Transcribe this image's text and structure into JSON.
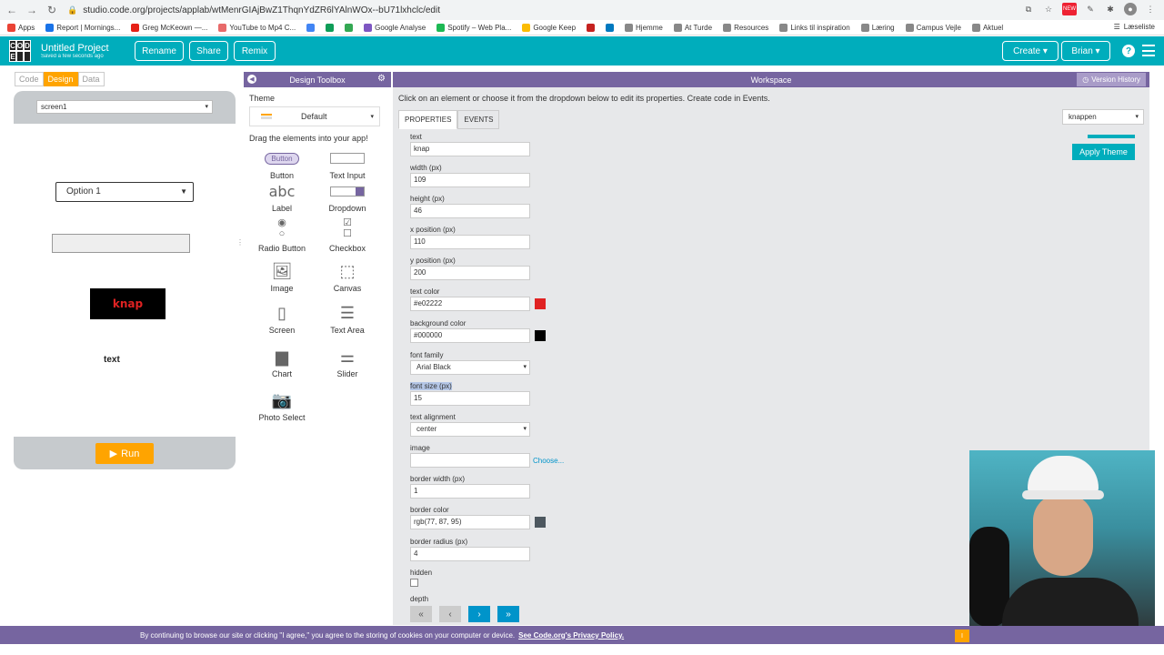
{
  "browser": {
    "url": "studio.code.org/projects/applab/wtMenrGIAjBwZ1ThqnYdZR6lYAlnWOx--bU71lxhclc/edit",
    "bookmarks": [
      {
        "label": "Apps",
        "color": "#ea4335"
      },
      {
        "label": "Report | Mornings...",
        "color": "#1a73e8"
      },
      {
        "label": "Greg McKeown —...",
        "color": "#e62117"
      },
      {
        "label": "YouTube to Mp4 C...",
        "color": "#e86a6a"
      },
      {
        "label": "",
        "color": "#4285f4"
      },
      {
        "label": "",
        "color": "#0f9d58"
      },
      {
        "label": "",
        "color": "#34a853"
      },
      {
        "label": "Google Analyse",
        "color": "#7e57c2"
      },
      {
        "label": "Spotify – Web Pla...",
        "color": "#1db954"
      },
      {
        "label": "Google Keep",
        "color": "#fbbc04"
      },
      {
        "label": "",
        "color": "#c5221f"
      },
      {
        "label": "",
        "color": "#0079bf"
      },
      {
        "label": "Hjemme",
        "color": "#888888"
      },
      {
        "label": "At Turde",
        "color": "#888888"
      },
      {
        "label": "Resources",
        "color": "#888888"
      },
      {
        "label": "Links til inspiration",
        "color": "#888888"
      },
      {
        "label": "Læring",
        "color": "#888888"
      },
      {
        "label": "Campus Vejle",
        "color": "#888888"
      },
      {
        "label": "Aktuel",
        "color": "#888888"
      }
    ],
    "reading_list": "Læseliste"
  },
  "header": {
    "logo_letters": [
      "C",
      "O",
      "D",
      "E",
      "",
      ""
    ],
    "project_name": "Untitled Project",
    "saved_text": "Saved a few seconds ago",
    "rename": "Rename",
    "share": "Share",
    "remix": "Remix",
    "create": "Create",
    "user": "Brian",
    "help": "?"
  },
  "left": {
    "modes": [
      "Code",
      "Design",
      "Data"
    ],
    "active_mode": "Design",
    "screen_select": "screen1",
    "dropdown_value": "Option 1",
    "button_text": "knap",
    "label_text": "text",
    "run": "Run"
  },
  "toolbox": {
    "title": "Design Toolbox",
    "theme_label": "Theme",
    "theme_value": "Default",
    "drag_tip": "Drag the elements into your app!",
    "widgets": {
      "button_icon_text": "Button",
      "button": "Button",
      "text_input": "Text Input",
      "label_icon_text": "abc",
      "label": "Label",
      "dropdown": "Dropdown",
      "radio_button": "Radio Button",
      "checkbox": "Checkbox",
      "image": "Image",
      "canvas": "Canvas",
      "screen": "Screen",
      "text_area": "Text Area",
      "chart": "Chart",
      "slider": "Slider",
      "photo_select": "Photo Select"
    }
  },
  "workspace": {
    "title": "Workspace",
    "version_history": "Version History",
    "tip": "Click on an element or choose it from the dropdown below to edit its properties. Create code in Events.",
    "tabs": [
      "PROPERTIES",
      "EVENTS"
    ],
    "element_select": "knappen",
    "apply_theme": "Apply Theme",
    "props": {
      "text_label": "text",
      "text": "knap",
      "width_label": "width (px)",
      "width": "109",
      "height_label": "height (px)",
      "height": "46",
      "x_label": "x position (px)",
      "x": "110",
      "y_label": "y position (px)",
      "y": "200",
      "text_color_label": "text color",
      "text_color": "#e02222",
      "bg_color_label": "background color",
      "bg_color": "#000000",
      "font_family_label": "font family",
      "font_family": "Arial Black",
      "font_size_label": "font size (px)",
      "font_size": "15",
      "text_align_label": "text alignment",
      "text_align": "center",
      "image_label": "image",
      "image": "",
      "choose": "Choose...",
      "border_width_label": "border width (px)",
      "border_width": "1",
      "border_color_label": "border color",
      "border_color": "rgb(77, 87, 95)",
      "border_radius_label": "border radius (px)",
      "border_radius": "4",
      "hidden_label": "hidden",
      "depth_label": "depth"
    },
    "swatches": {
      "text": "#e02222",
      "bg": "#000000",
      "border": "#4d575f"
    },
    "depth_buttons": [
      "«",
      "‹",
      "›",
      "»"
    ]
  },
  "cookie": {
    "text": "By continuing to browse our site or clicking \"I agree,\" you agree to the storing of cookies on your computer or device.",
    "link": "See Code.org's Privacy Policy.",
    "agree": "I"
  }
}
